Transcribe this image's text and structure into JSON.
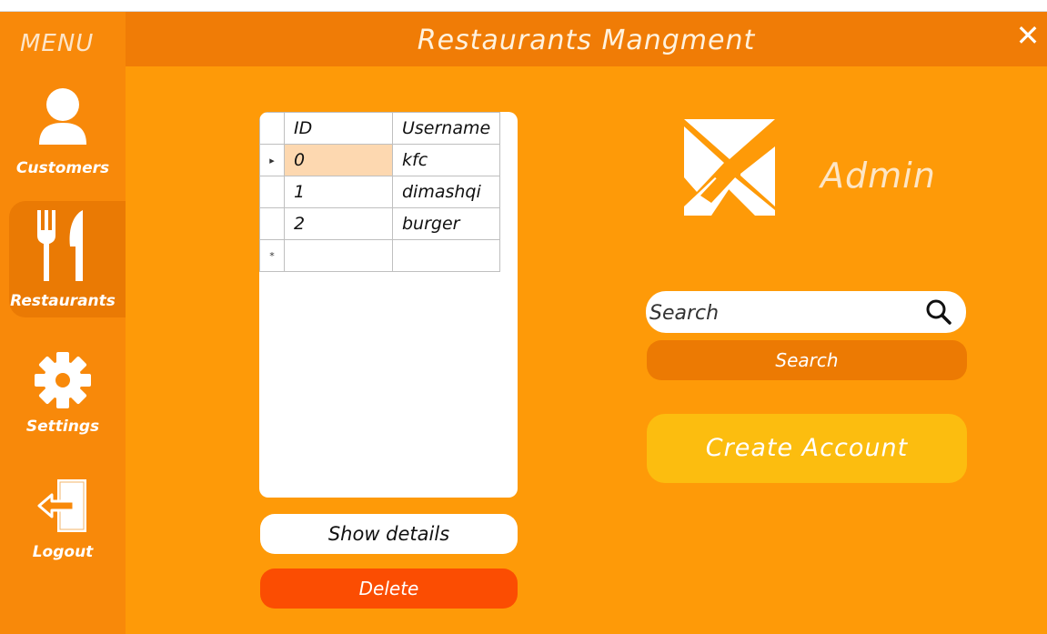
{
  "app": {
    "title": "Restaurants Mangment",
    "close_symbol": "✕"
  },
  "sidebar": {
    "menu_label": "MENU",
    "items": [
      {
        "label": "Customers",
        "icon": "user-icon",
        "active": false
      },
      {
        "label": "Restaurants",
        "icon": "fork-knife-icon",
        "active": true
      },
      {
        "label": "Settings",
        "icon": "gear-icon",
        "active": false
      },
      {
        "label": "Logout",
        "icon": "logout-icon",
        "active": false
      }
    ]
  },
  "table": {
    "columns": [
      "ID",
      "Username"
    ],
    "rows": [
      {
        "id": "0",
        "username": "kfc",
        "indicator": "▸"
      },
      {
        "id": "1",
        "username": "dimashqi",
        "indicator": ""
      },
      {
        "id": "2",
        "username": "burger",
        "indicator": ""
      }
    ],
    "new_row_indicator": "*"
  },
  "buttons": {
    "show_details": "Show details",
    "delete": "Delete",
    "search": "Search",
    "create_account": "Create Account"
  },
  "search": {
    "placeholder": "Search",
    "value": ""
  },
  "user": {
    "role": "Admin",
    "logo_icon": "x-logo-icon"
  },
  "colors": {
    "background": "#fe9a08",
    "sidebar": "#f8890a",
    "topbar": "#f07c06",
    "delete": "#fb4d02",
    "create": "#fcbd0f",
    "search_button": "#ec7a03"
  }
}
